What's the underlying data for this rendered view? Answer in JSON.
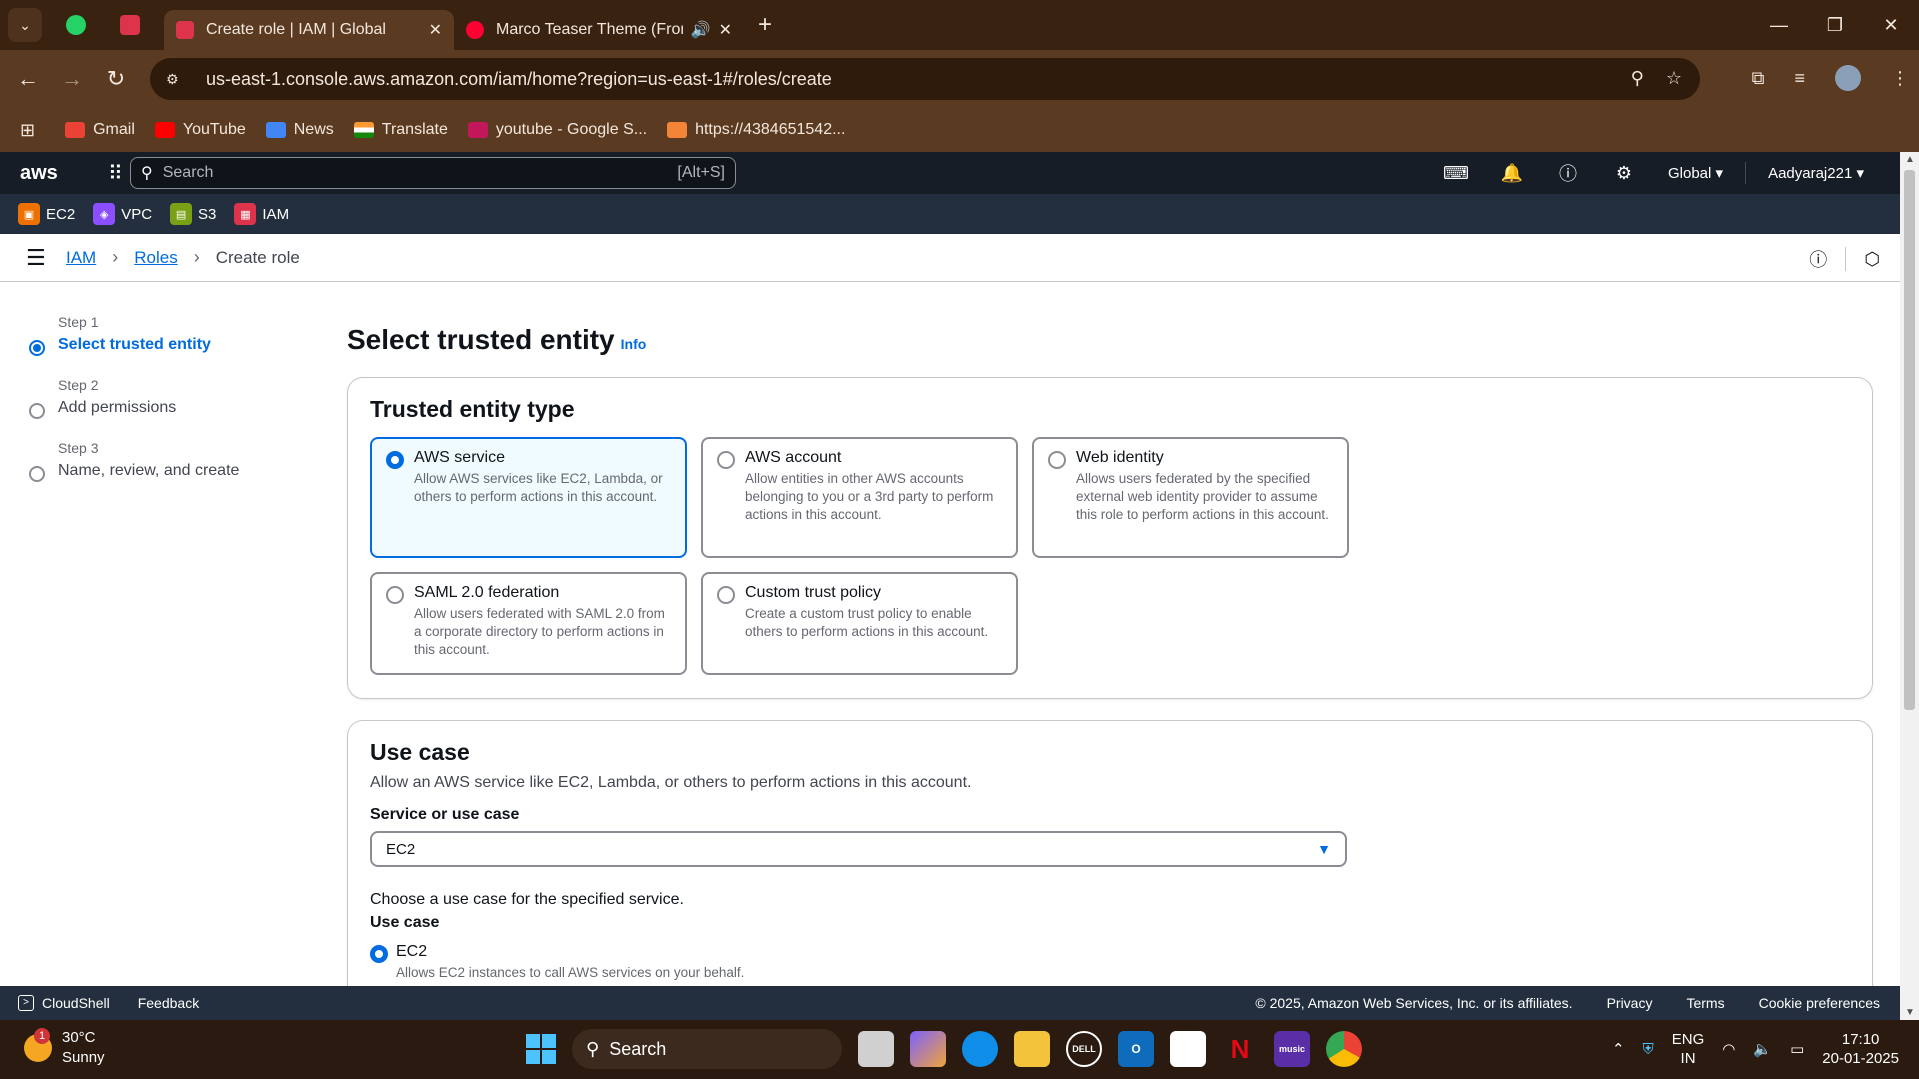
{
  "browser": {
    "tabs": [
      {
        "title": "Create role | IAM | Global",
        "active": true
      },
      {
        "title": "Marco Teaser Theme (From",
        "active": false
      }
    ],
    "url": "us-east-1.console.aws.amazon.com/iam/home?region=us-east-1#/roles/create",
    "bookmarks": [
      {
        "label": "Gmail",
        "icon": "gmail-icon",
        "color": "#ea4335"
      },
      {
        "label": "YouTube",
        "icon": "youtube-icon",
        "color": "#ff0000"
      },
      {
        "label": "News",
        "icon": "google-news-icon",
        "color": "#4285f4"
      },
      {
        "label": "Translate",
        "icon": "india-flag-icon",
        "color": "#ff9933"
      },
      {
        "label": "youtube - Google S...",
        "icon": "su-icon",
        "color": "#c2185b"
      },
      {
        "label": "https://4384651542...",
        "icon": "package-icon",
        "color": "#f58536"
      }
    ]
  },
  "aws": {
    "logo": "aws",
    "search_placeholder": "Search",
    "search_shortcut": "[Alt+S]",
    "region": "Global ▾",
    "user": "Aadyaraj221 ▾",
    "favorites": [
      {
        "label": "EC2",
        "color": "#ed7100"
      },
      {
        "label": "VPC",
        "color": "#8c4fff"
      },
      {
        "label": "S3",
        "color": "#7aa116"
      },
      {
        "label": "IAM",
        "color": "#dd344c"
      }
    ]
  },
  "breadcrumb": {
    "iam": "IAM",
    "roles": "Roles",
    "current": "Create role"
  },
  "steps": [
    {
      "label": "Step 1",
      "name": "Select trusted entity",
      "active": true
    },
    {
      "label": "Step 2",
      "name": "Add permissions",
      "active": false
    },
    {
      "label": "Step 3",
      "name": "Name, review, and create",
      "active": false
    }
  ],
  "page": {
    "title": "Select trusted entity",
    "info": "Info"
  },
  "trusted_entity": {
    "title": "Trusted entity type",
    "options": [
      {
        "name": "AWS service",
        "desc": "Allow AWS services like EC2, Lambda, or others to perform actions in this account.",
        "selected": true
      },
      {
        "name": "AWS account",
        "desc": "Allow entities in other AWS accounts belonging to you or a 3rd party to perform actions in this account.",
        "selected": false
      },
      {
        "name": "Web identity",
        "desc": "Allows users federated by the specified external web identity provider to assume this role to perform actions in this account.",
        "selected": false
      },
      {
        "name": "SAML 2.0 federation",
        "desc": "Allow users federated with SAML 2.0 from a corporate directory to perform actions in this account.",
        "selected": false
      },
      {
        "name": "Custom trust policy",
        "desc": "Create a custom trust policy to enable others to perform actions in this account.",
        "selected": false
      }
    ]
  },
  "use_case": {
    "title": "Use case",
    "desc": "Allow an AWS service like EC2, Lambda, or others to perform actions in this account.",
    "service_label": "Service or use case",
    "service_value": "EC2",
    "choose_text": "Choose a use case for the specified service.",
    "use_case_label": "Use case",
    "selected_name": "EC2",
    "selected_desc": "Allows EC2 instances to call AWS services on your behalf."
  },
  "footer": {
    "cloudshell": "CloudShell",
    "feedback": "Feedback",
    "copyright": "© 2025, Amazon Web Services, Inc. or its affiliates.",
    "privacy": "Privacy",
    "terms": "Terms",
    "cookies": "Cookie preferences"
  },
  "taskbar": {
    "weather_temp": "30°C",
    "weather_desc": "Sunny",
    "weather_badge": "1",
    "search": "Search",
    "lang_1": "ENG",
    "lang_2": "IN",
    "time": "17:10",
    "date": "20-01-2025",
    "apps": [
      {
        "name": "task-view-icon",
        "color": "#d0d0d0",
        "text": ""
      },
      {
        "name": "copilot-icon",
        "color": "#7b61ff",
        "text": ""
      },
      {
        "name": "edge-icon",
        "color": "#0e8ee9",
        "text": ""
      },
      {
        "name": "file-explorer-icon",
        "color": "#f3c33b",
        "text": ""
      },
      {
        "name": "dell-icon",
        "color": "#2a1a10",
        "text": "DELL"
      },
      {
        "name": "outlook-icon",
        "color": "#0f6cbd",
        "text": "O"
      },
      {
        "name": "store-icon",
        "color": "#ffffff",
        "text": ""
      },
      {
        "name": "netflix-icon",
        "color": "#2a1a10",
        "text": "N"
      },
      {
        "name": "amazon-music-icon",
        "color": "#5a2ea6",
        "text": "music"
      },
      {
        "name": "chrome-icon",
        "color": "#4caf50",
        "text": ""
      }
    ]
  }
}
